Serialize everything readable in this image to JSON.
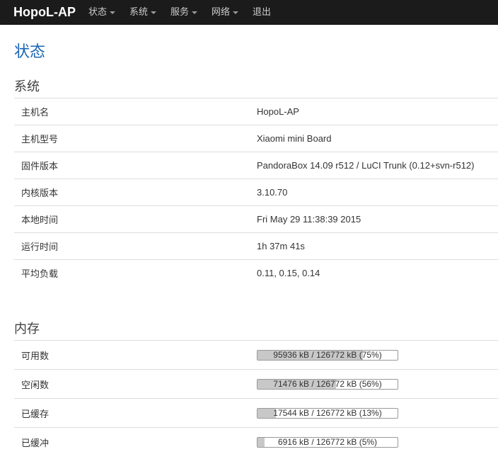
{
  "navbar": {
    "brand": "HopoL-AP",
    "items": [
      {
        "label": "状态",
        "dropdown": true
      },
      {
        "label": "系统",
        "dropdown": true
      },
      {
        "label": "服务",
        "dropdown": true
      },
      {
        "label": "网络",
        "dropdown": true
      },
      {
        "label": "退出",
        "dropdown": false
      }
    ]
  },
  "page_title": "状态",
  "system": {
    "title": "系统",
    "rows": [
      {
        "label": "主机名",
        "value": "HopoL-AP"
      },
      {
        "label": "主机型号",
        "value": "Xiaomi mini Board"
      },
      {
        "label": "固件版本",
        "value": "PandoraBox 14.09 r512 / LuCI Trunk (0.12+svn-r512)"
      },
      {
        "label": "内核版本",
        "value": "3.10.70"
      },
      {
        "label": "本地时间",
        "value": "Fri May 29 11:38:39 2015"
      },
      {
        "label": "运行时间",
        "value": "1h 37m 41s"
      },
      {
        "label": "平均负载",
        "value": "0.11, 0.15, 0.14"
      }
    ]
  },
  "memory": {
    "title": "内存",
    "rows": [
      {
        "label": "可用数",
        "text": "95936 kB / 126772 kB (75%)",
        "percent": 75
      },
      {
        "label": "空闲数",
        "text": "71476 kB / 126772 kB (56%)",
        "percent": 56
      },
      {
        "label": "已缓存",
        "text": "17544 kB / 126772 kB (13%)",
        "percent": 13
      },
      {
        "label": "已缓冲",
        "text": "6916 kB / 126772 kB (5%)",
        "percent": 5
      }
    ]
  },
  "colors": {
    "navbar_bg": "#1b1b1b",
    "title_blue": "#1a65b5",
    "bar_fill": "#c8c8c8"
  }
}
